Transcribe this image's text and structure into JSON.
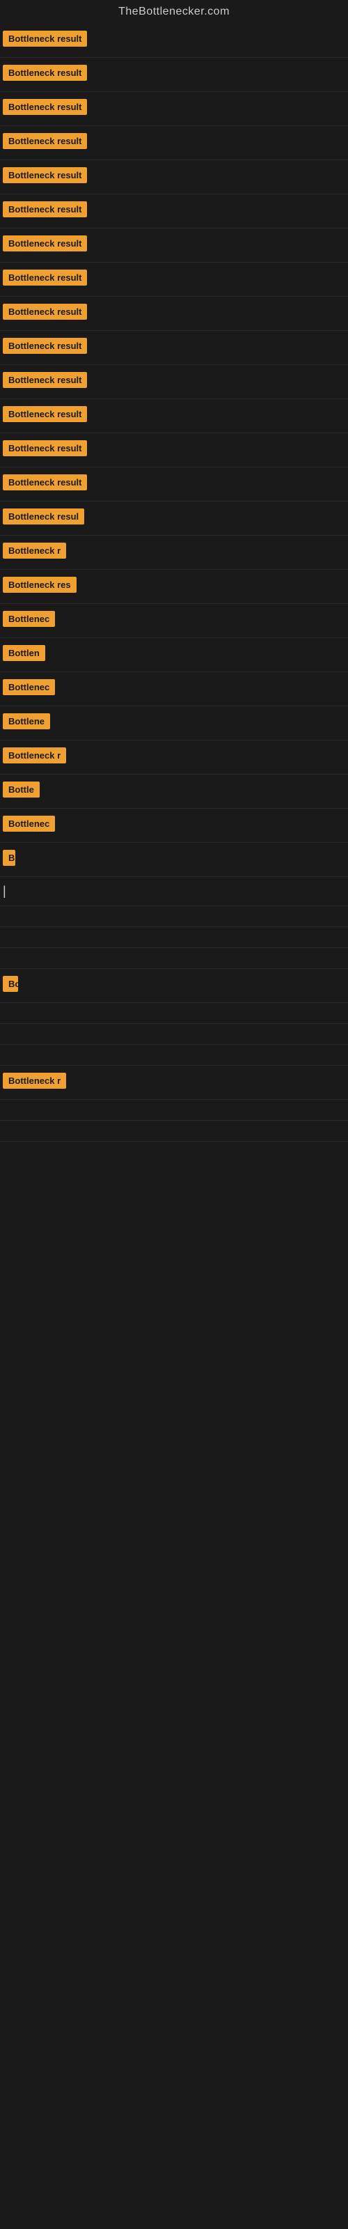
{
  "site": {
    "title": "TheBottlenecker.com"
  },
  "results": [
    {
      "id": 1,
      "label": "Bottleneck result",
      "visible_width": "full"
    },
    {
      "id": 2,
      "label": "Bottleneck result",
      "visible_width": "full"
    },
    {
      "id": 3,
      "label": "Bottleneck result",
      "visible_width": "full"
    },
    {
      "id": 4,
      "label": "Bottleneck result",
      "visible_width": "full"
    },
    {
      "id": 5,
      "label": "Bottleneck result",
      "visible_width": "full"
    },
    {
      "id": 6,
      "label": "Bottleneck result",
      "visible_width": "full"
    },
    {
      "id": 7,
      "label": "Bottleneck result",
      "visible_width": "full"
    },
    {
      "id": 8,
      "label": "Bottleneck result",
      "visible_width": "full"
    },
    {
      "id": 9,
      "label": "Bottleneck result",
      "visible_width": "full"
    },
    {
      "id": 10,
      "label": "Bottleneck result",
      "visible_width": "full"
    },
    {
      "id": 11,
      "label": "Bottleneck result",
      "visible_width": "full"
    },
    {
      "id": 12,
      "label": "Bottleneck result",
      "visible_width": "full"
    },
    {
      "id": 13,
      "label": "Bottleneck result",
      "visible_width": "full"
    },
    {
      "id": 14,
      "label": "Bottleneck result",
      "visible_width": "full"
    },
    {
      "id": 15,
      "label": "Bottleneck resul",
      "visible_width": "partial1"
    },
    {
      "id": 16,
      "label": "Bottleneck r",
      "visible_width": "partial2"
    },
    {
      "id": 17,
      "label": "Bottleneck res",
      "visible_width": "partial3"
    },
    {
      "id": 18,
      "label": "Bottlenec",
      "visible_width": "partial4"
    },
    {
      "id": 19,
      "label": "Bottlen",
      "visible_width": "partial5"
    },
    {
      "id": 20,
      "label": "Bottlenec",
      "visible_width": "partial4"
    },
    {
      "id": 21,
      "label": "Bottlene",
      "visible_width": "partial6"
    },
    {
      "id": 22,
      "label": "Bottleneck r",
      "visible_width": "partial2"
    },
    {
      "id": 23,
      "label": "Bottle",
      "visible_width": "partial7"
    },
    {
      "id": 24,
      "label": "Bottlenec",
      "visible_width": "partial4"
    },
    {
      "id": 25,
      "label": "B",
      "visible_width": "tiny"
    },
    {
      "id": 26,
      "label": "|",
      "visible_width": "cursor"
    },
    {
      "id": 27,
      "label": "",
      "visible_width": "empty"
    },
    {
      "id": 28,
      "label": "",
      "visible_width": "empty"
    },
    {
      "id": 29,
      "label": "",
      "visible_width": "empty"
    },
    {
      "id": 30,
      "label": "Bo",
      "visible_width": "micro"
    },
    {
      "id": 31,
      "label": "",
      "visible_width": "empty"
    },
    {
      "id": 32,
      "label": "",
      "visible_width": "empty"
    },
    {
      "id": 33,
      "label": "",
      "visible_width": "empty"
    },
    {
      "id": 34,
      "label": "Bottleneck r",
      "visible_width": "partial2"
    },
    {
      "id": 35,
      "label": "",
      "visible_width": "empty"
    },
    {
      "id": 36,
      "label": "",
      "visible_width": "empty"
    }
  ]
}
